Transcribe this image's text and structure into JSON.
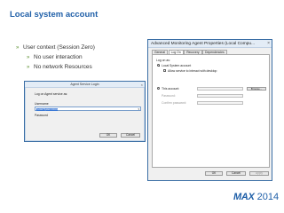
{
  "slide": {
    "title": "Local system account",
    "bullets": [
      {
        "text": "User context (Session Zero)",
        "level": 1
      },
      {
        "text": "No user interaction",
        "level": 2
      },
      {
        "text": "No network Resources",
        "level": 2
      }
    ]
  },
  "login_dialog": {
    "title": "Agent Service Login",
    "close": "×",
    "logon_label": "Log on Agent service as:",
    "username_label": "Username",
    "username_value": "Local System Account",
    "password_label": "Password",
    "ok": "OK",
    "cancel": "Cancel"
  },
  "properties_dialog": {
    "title": "Advanced Monitoring Agent Properties (Local Compu...",
    "close": "×",
    "tabs": [
      "General",
      "Log On",
      "Recovery",
      "Dependencies"
    ],
    "active_tab": "Log On",
    "logon_as": "Log on as:",
    "local_system": "Local System account",
    "allow_interact": "Allow service to interact with desktop",
    "this_account": "This account:",
    "browse": "Browse...",
    "password": "Password:",
    "confirm_password": "Confirm password:",
    "ok": "OK",
    "cancel": "Cancel",
    "apply": "Apply"
  },
  "logo": {
    "brand": "MAX",
    "year": "2014"
  },
  "colors": {
    "title": "#1f5fa8",
    "bullet": "#5a8f2e",
    "selection": "#3a78d6"
  }
}
